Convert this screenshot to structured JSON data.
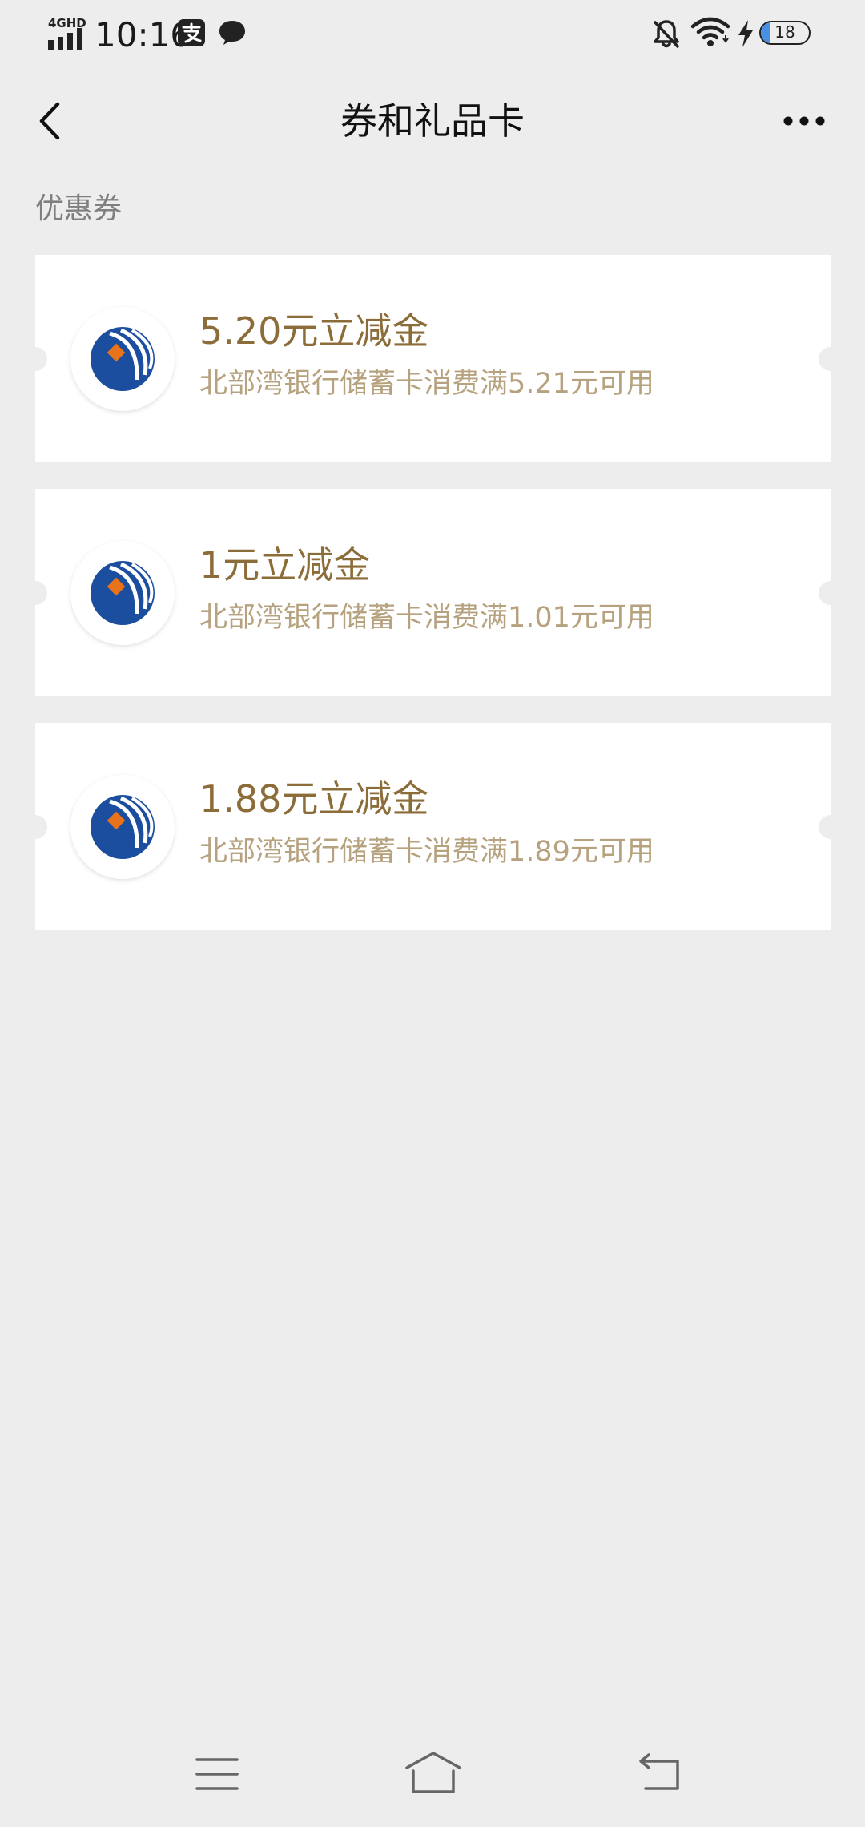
{
  "status_bar": {
    "network": "4GHD",
    "time": "10:16",
    "battery": "18",
    "battery_level": 0.18
  },
  "nav": {
    "title": "券和礼品卡"
  },
  "section": {
    "label": "优惠券"
  },
  "coupons": [
    {
      "title": "5.20元立减金",
      "condition": "北部湾银行储蓄卡消费满5.21元可用"
    },
    {
      "title": "1元立减金",
      "condition": "北部湾银行储蓄卡消费满1.01元可用"
    },
    {
      "title": "1.88元立减金",
      "condition": "北部湾银行储蓄卡消费满1.89元可用"
    }
  ],
  "icons": {
    "back": "back-arrow-icon",
    "more": "more-dots-icon",
    "bank_logo": "bank-logo-icon"
  },
  "colors": {
    "background": "#ededed",
    "card": "#ffffff",
    "coupon_title": "#8c6d3a",
    "coupon_condition": "#b6a27e",
    "bank_blue": "#1c4ea0",
    "bank_orange": "#e8731a"
  }
}
